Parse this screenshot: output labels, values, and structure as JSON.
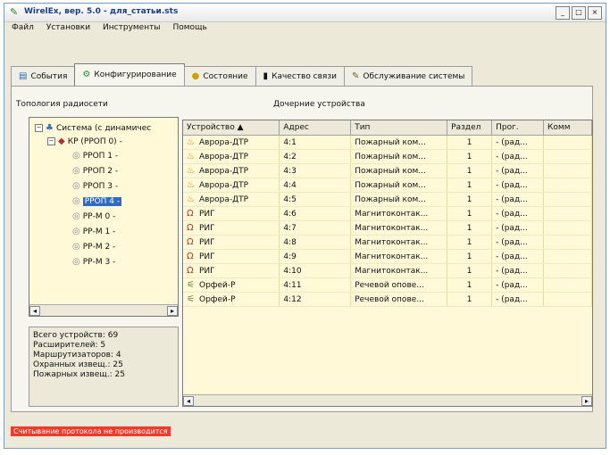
{
  "window": {
    "title": "WirelEx, вер. 5.0 - для_статьи.sts",
    "controls": [
      "_",
      "□",
      "×"
    ]
  },
  "menu": [
    "Файл",
    "Установки",
    "Инструменты",
    "Помощь"
  ],
  "tabs": [
    {
      "label": "События",
      "icon": "events-icon"
    },
    {
      "label": "Конфигурирование",
      "icon": "config-icon",
      "active": true
    },
    {
      "label": "Состояние",
      "icon": "state-icon"
    },
    {
      "label": "Качество связи",
      "icon": "signal-icon"
    },
    {
      "label": "Обслуживание системы",
      "icon": "maintenance-icon"
    }
  ],
  "topology": {
    "label": "Топология радиосети",
    "root": "Система (с динамичес",
    "controller": "КР (РРОП 0) -",
    "nodes": [
      "РРОП 1 -",
      "РРОП 2 -",
      "РРОП 3 -",
      "РРОП 4 -",
      "РР-М 0 -",
      "РР-М 1 -",
      "РР-М 2 -",
      "РР-М 3 -"
    ],
    "selected_index": 3
  },
  "stats": [
    "Всего устройств: 69",
    "Расширителей: 5",
    "Маршрутизаторов: 4",
    "Охранных извещ.: 25",
    "Пожарных извещ.: 25"
  ],
  "child_devices": {
    "label": "Дочерние устройства",
    "columns": [
      "Устройство  ▲",
      "Адрес",
      "Тип",
      "Раздел",
      "Прог.",
      "Комм"
    ],
    "rows": [
      {
        "icon": "flame-icon",
        "device": "Аврора-ДТР",
        "address": "4:1",
        "type": "Пожарный ком...",
        "section": "1",
        "prog": "- (рад..."
      },
      {
        "icon": "flame-icon",
        "device": "Аврора-ДТР",
        "address": "4:2",
        "type": "Пожарный ком...",
        "section": "1",
        "prog": "- (рад..."
      },
      {
        "icon": "flame-icon",
        "device": "Аврора-ДТР",
        "address": "4:3",
        "type": "Пожарный ком...",
        "section": "1",
        "prog": "- (рад..."
      },
      {
        "icon": "flame-icon",
        "device": "Аврора-ДТР",
        "address": "4:4",
        "type": "Пожарный ком...",
        "section": "1",
        "prog": "- (рад..."
      },
      {
        "icon": "flame-icon",
        "device": "Аврора-ДТР",
        "address": "4:5",
        "type": "Пожарный ком...",
        "section": "1",
        "prog": "- (рад..."
      },
      {
        "icon": "magnet-icon",
        "device": "РИГ",
        "address": "4:6",
        "type": "Магнитоконтак...",
        "section": "1",
        "prog": "- (рад..."
      },
      {
        "icon": "magnet-icon",
        "device": "РИГ",
        "address": "4:7",
        "type": "Магнитоконтак...",
        "section": "1",
        "prog": "- (рад..."
      },
      {
        "icon": "magnet-icon",
        "device": "РИГ",
        "address": "4:8",
        "type": "Магнитоконтак...",
        "section": "1",
        "prog": "- (рад..."
      },
      {
        "icon": "magnet-icon",
        "device": "РИГ",
        "address": "4:9",
        "type": "Магнитоконтак...",
        "section": "1",
        "prog": "- (рад..."
      },
      {
        "icon": "magnet-icon",
        "device": "РИГ",
        "address": "4:10",
        "type": "Магнитоконтак...",
        "section": "1",
        "prog": "- (рад..."
      },
      {
        "icon": "horn-icon",
        "device": "Орфей-Р",
        "address": "4:11",
        "type": "Речевой опове...",
        "section": "1",
        "prog": "- (рад..."
      },
      {
        "icon": "horn-icon",
        "device": "Орфей-Р",
        "address": "4:12",
        "type": "Речевой опове...",
        "section": "1",
        "prog": "- (рад..."
      }
    ]
  },
  "status": "Считывание протокола не производится"
}
